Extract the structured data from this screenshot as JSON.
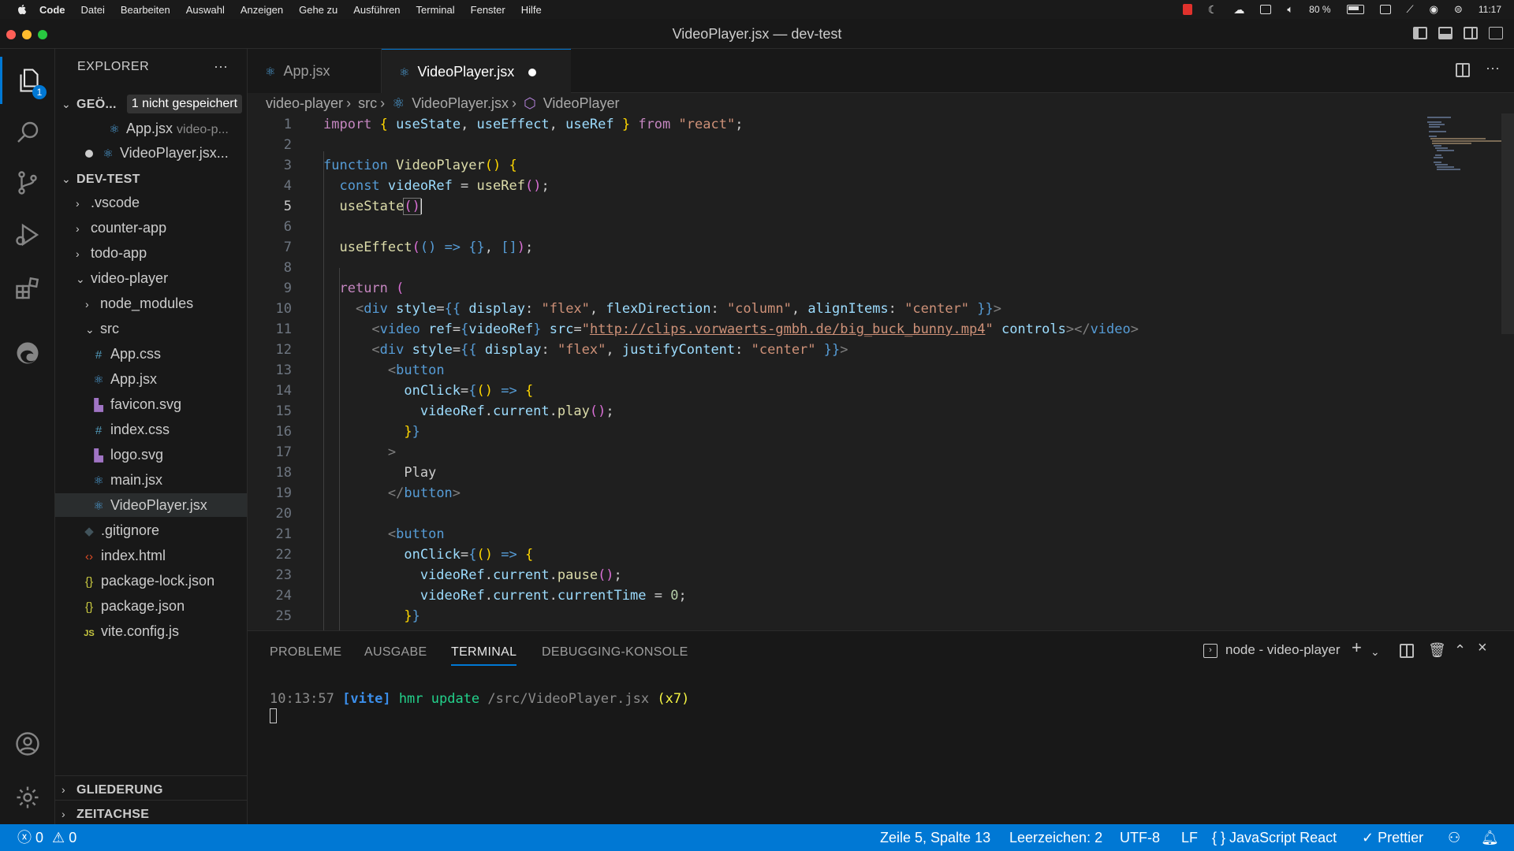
{
  "menubar": {
    "app_name": "Code",
    "items": [
      "Datei",
      "Bearbeiten",
      "Auswahl",
      "Anzeigen",
      "Gehe zu",
      "Ausführen",
      "Terminal",
      "Fenster",
      "Hilfe"
    ],
    "battery": "80 %",
    "clock": "11:17"
  },
  "window": {
    "title": "VideoPlayer.jsx — dev-test"
  },
  "activity_bar": {
    "explorer_badge": "1"
  },
  "sidebar": {
    "title": "EXPLORER",
    "more": "···",
    "open_editors": {
      "label": "GEÖ...",
      "badge": "1 nicht gespeichert",
      "items": [
        {
          "name": "App.jsx",
          "hint": "video-p..."
        },
        {
          "name": "VideoPlayer.jsx..."
        }
      ]
    },
    "workspace": {
      "label": "DEV-TEST",
      "items": [
        {
          "name": ".vscode"
        },
        {
          "name": "counter-app"
        },
        {
          "name": "todo-app"
        },
        {
          "name": "video-player"
        },
        {
          "name": "node_modules"
        },
        {
          "name": "src"
        },
        {
          "name": "App.css"
        },
        {
          "name": "App.jsx"
        },
        {
          "name": "favicon.svg"
        },
        {
          "name": "index.css"
        },
        {
          "name": "logo.svg"
        },
        {
          "name": "main.jsx"
        },
        {
          "name": "VideoPlayer.jsx"
        },
        {
          "name": ".gitignore"
        },
        {
          "name": "index.html"
        },
        {
          "name": "package-lock.json"
        },
        {
          "name": "package.json"
        },
        {
          "name": "vite.config.js"
        }
      ]
    },
    "outline": "GLIEDERUNG",
    "timeline": "ZEITACHSE"
  },
  "tabs": [
    {
      "label": "App.jsx"
    },
    {
      "label": "VideoPlayer.jsx"
    }
  ],
  "breadcrumb": [
    "video-player",
    "src",
    "VideoPlayer.jsx",
    "VideoPlayer"
  ],
  "editor": {
    "line_numbers": [
      "1",
      "2",
      "3",
      "4",
      "5",
      "6",
      "7",
      "8",
      "9",
      "10",
      "11",
      "12",
      "13",
      "14",
      "15",
      "16",
      "17",
      "18",
      "19",
      "20",
      "21",
      "22",
      "23",
      "24",
      "25"
    ]
  },
  "panel": {
    "tabs": [
      "PROBLEME",
      "AUSGABE",
      "TERMINAL",
      "DEBUGGING-KONSOLE"
    ],
    "terminal_name": "node - video-player",
    "output": {
      "time": "10:13:57",
      "tag": "[vite]",
      "msg": "hmr update",
      "path": "/src/VideoPlayer.jsx",
      "count": "(x7)"
    }
  },
  "statusbar": {
    "errors": "0",
    "warnings": "0",
    "position": "Zeile 5, Spalte 13",
    "indent": "Leerzeichen: 2",
    "encoding": "UTF-8",
    "eol": "LF",
    "language": "JavaScript React",
    "formatter": "Prettier"
  }
}
